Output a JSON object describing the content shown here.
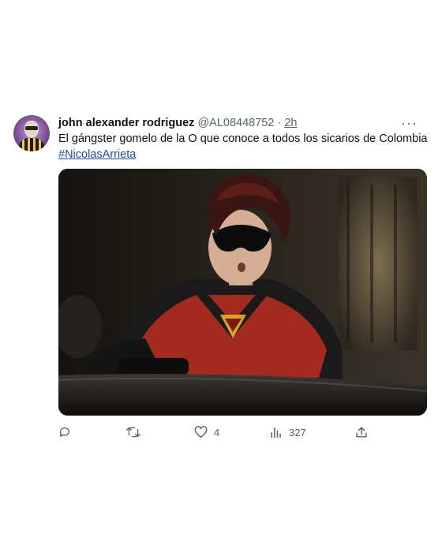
{
  "tweet": {
    "author": {
      "name": "john alexander rodriguez",
      "handle": "@AL08448752",
      "separator": "·",
      "time": "2h"
    },
    "more_label": "···",
    "text": "El gángster gomelo de la O que conoce a todos los sicarios de Colombia",
    "hashtag": "#NicolasArrieta",
    "media": {
      "description_icon": "photo",
      "accent_color": "#c0392b"
    },
    "actions": {
      "reply_count": "",
      "retweet_count": "",
      "like_count": "4",
      "views_count": "327"
    },
    "icons": {
      "reply": "reply-icon",
      "retweet": "retweet-icon",
      "like": "heart-icon",
      "views": "views-icon",
      "share": "share-icon",
      "more": "more-icon"
    },
    "colors": {
      "text": "#0f1419",
      "secondary": "#536471",
      "link": "#1d4f91"
    }
  }
}
